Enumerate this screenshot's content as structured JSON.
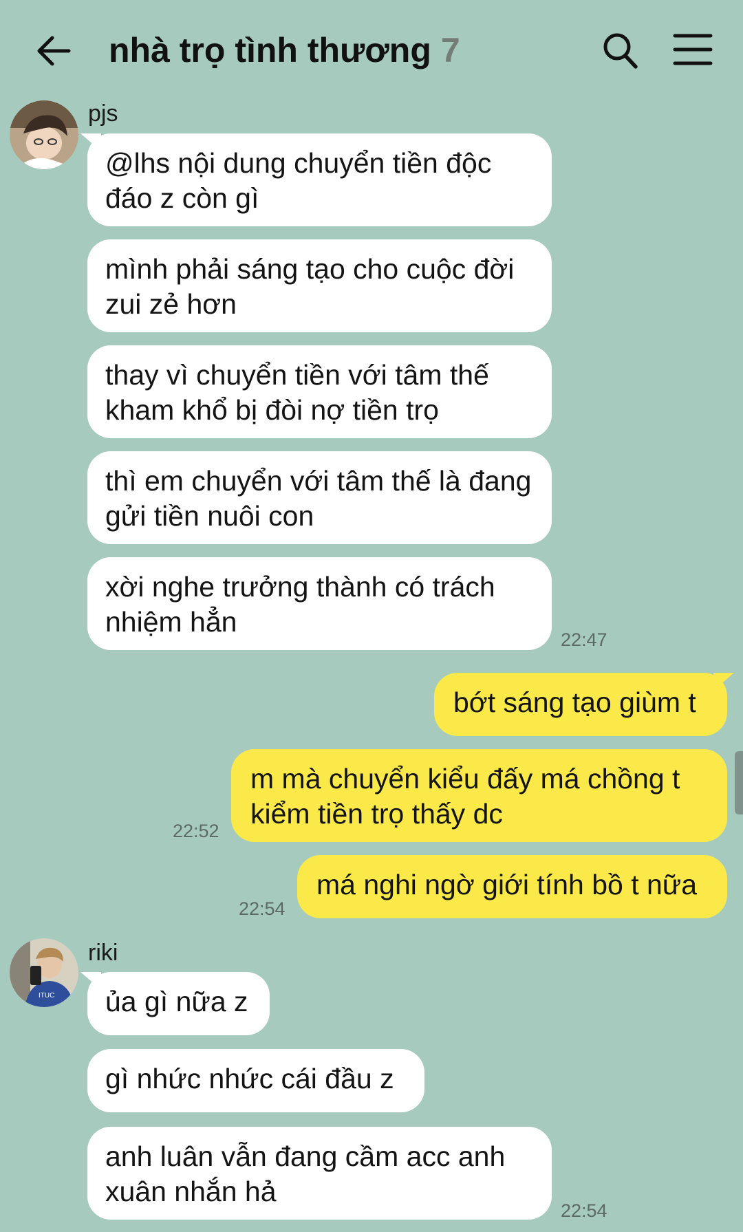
{
  "header": {
    "title": "nhà trọ tình thương",
    "member_count": "7",
    "back_icon": "arrow-left-icon",
    "search_icon": "search-icon",
    "menu_icon": "hamburger-menu-icon"
  },
  "colors": {
    "background": "#a6cbbe",
    "incoming_bubble": "#ffffff",
    "outgoing_bubble": "#fbe94a"
  },
  "groups": [
    {
      "sender": "pjs",
      "messages": [
        "@lhs nội dung chuyển tiền độc đáo z còn gì",
        "mình phải sáng tạo cho cuộc đời zui zẻ hơn",
        "thay vì chuyển tiền với tâm thế kham khổ bị đòi nợ tiền trọ",
        "thì em chuyển với tâm thế là đang gửi tiền nuôi con",
        "xời nghe trưởng thành có trách nhiệm hẳn"
      ],
      "time": "22:47"
    },
    {
      "sender": "me",
      "messages": [
        "bớt sáng tạo giùm t",
        "m mà chuyển kiểu đấy má chồng t kiểm tiền trọ thấy dc",
        "má nghi ngờ giới tính bồ t nữa"
      ],
      "times": [
        "22:52",
        "22:54"
      ]
    },
    {
      "sender": "riki",
      "messages": [
        "ủa gì nữa z",
        "gì nhức nhức cái đầu z",
        "anh luân vẫn đang cầm acc anh xuân nhắn hả"
      ],
      "time": "22:54"
    }
  ]
}
